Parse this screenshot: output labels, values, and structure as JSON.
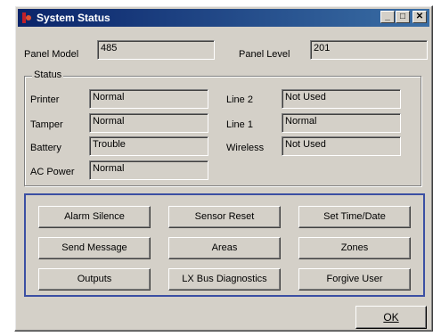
{
  "window": {
    "title": "System Status",
    "controls": {
      "minimize": "_",
      "maximize": "□",
      "close": "✕"
    }
  },
  "panel": {
    "model_label": "Panel Model",
    "model_value": "485",
    "level_label": "Panel Level",
    "level_value": "201"
  },
  "status": {
    "group_title": "Status",
    "left": [
      {
        "label": "Printer",
        "value": "Normal"
      },
      {
        "label": "Tamper",
        "value": "Normal"
      },
      {
        "label": "Battery",
        "value": "Trouble"
      },
      {
        "label": "AC Power",
        "value": "Normal"
      }
    ],
    "right": [
      {
        "label": "Line 2",
        "value": "Not Used"
      },
      {
        "label": "Line 1",
        "value": "Normal"
      },
      {
        "label": "Wireless",
        "value": "Not Used"
      }
    ]
  },
  "buttons": [
    "Alarm Silence",
    "Sensor Reset",
    "Set Time/Date",
    "Send Message",
    "Areas",
    "Zones",
    "Outputs",
    "LX Bus Diagnostics",
    "Forgive User"
  ],
  "ok_label": "OK"
}
